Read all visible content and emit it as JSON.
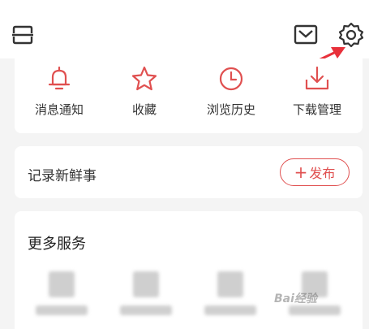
{
  "header": {
    "icons": [
      "scan-icon",
      "mail-icon",
      "settings-gear-icon"
    ]
  },
  "annotation": {
    "arrow_color": "#e8303a"
  },
  "quick_actions": [
    {
      "label": "消息通知",
      "icon": "bell-icon"
    },
    {
      "label": "收藏",
      "icon": "star-icon"
    },
    {
      "label": "浏览历史",
      "icon": "clock-icon"
    },
    {
      "label": "下载管理",
      "icon": "download-icon"
    }
  ],
  "post": {
    "title": "记录新鲜事",
    "button_label": "发布",
    "button_icon": "plus-icon"
  },
  "more_services": {
    "title": "更多服务"
  },
  "watermark": {
    "text": "Bai经验"
  },
  "colors": {
    "accent": "#e05050",
    "background": "#f4f4f4",
    "card": "#ffffff"
  }
}
